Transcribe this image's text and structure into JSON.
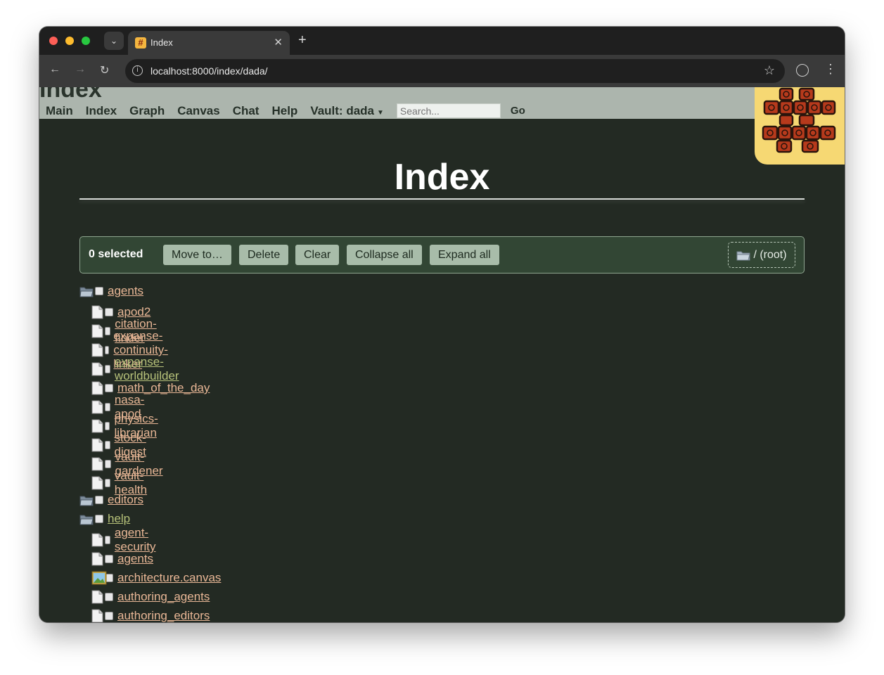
{
  "browser": {
    "tab_title": "Index",
    "favicon": "#",
    "url": "localhost:8000/index/dada/"
  },
  "site": {
    "title": "Index",
    "nav": [
      "Main",
      "Index",
      "Graph",
      "Canvas",
      "Chat",
      "Help"
    ],
    "vault_label": "Vault: dada",
    "search_placeholder": "Search...",
    "go_label": "Go"
  },
  "page": {
    "heading": "Index"
  },
  "actions": {
    "selected": "0 selected",
    "move": "Move to…",
    "delete": "Delete",
    "clear": "Clear",
    "collapse": "Collapse all",
    "expand": "Expand all",
    "root": "/ (root)"
  },
  "tree": [
    {
      "label": "agents",
      "kind": "folder"
    },
    {
      "label": "apod2",
      "kind": "doc"
    },
    {
      "label": "citation-finder",
      "kind": "doc"
    },
    {
      "label": "expanse-continuity-linker",
      "kind": "doc"
    },
    {
      "label": "expanse-worldbuilder",
      "kind": "doc",
      "visited": true
    },
    {
      "label": "math_of_the_day",
      "kind": "doc"
    },
    {
      "label": "nasa-apod",
      "kind": "doc"
    },
    {
      "label": "physics-librarian",
      "kind": "doc"
    },
    {
      "label": "stock-digest",
      "kind": "doc"
    },
    {
      "label": "vault-gardener",
      "kind": "doc"
    },
    {
      "label": "vault-health",
      "kind": "doc"
    },
    {
      "label": "editors",
      "kind": "folder"
    },
    {
      "label": "help",
      "kind": "folder",
      "visited": true
    },
    {
      "label": "agent-security",
      "kind": "doc"
    },
    {
      "label": "agents",
      "kind": "doc"
    },
    {
      "label": "architecture.canvas",
      "kind": "image"
    },
    {
      "label": "authoring_agents",
      "kind": "doc"
    },
    {
      "label": "authoring_editors",
      "kind": "doc"
    }
  ],
  "colors": {
    "link": "#e9b796",
    "link_visited": "#b7c27a",
    "background": "#232a23",
    "header": "#acb5ad"
  }
}
